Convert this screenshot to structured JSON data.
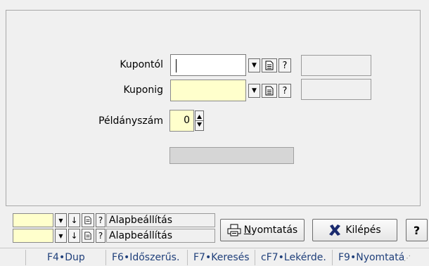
{
  "form": {
    "kupontol_label": "Kupontól",
    "kuponig_label": "Kuponig",
    "peldanyszam_label": "Példányszám",
    "peldanyszam_value": "0",
    "help_glyph": "?"
  },
  "bottom": {
    "alap1": "Alapbeállítás",
    "alap2": "Alapbeállítás",
    "print_label": "Nyomtatás",
    "print_mnemonic": "N",
    "print_rest": "yomtatás",
    "exit_label": "Kilépés",
    "help_label": "?"
  },
  "statusbar": {
    "items": [
      "F4•Dup",
      "F6•Időszerűs.",
      "F7•Keresés",
      "cF7•Lekérde.",
      "F9•Nyomtatá"
    ]
  },
  "colors": {
    "yellow_field": "#ffffcc",
    "exit_icon": "#1a2a6e"
  }
}
